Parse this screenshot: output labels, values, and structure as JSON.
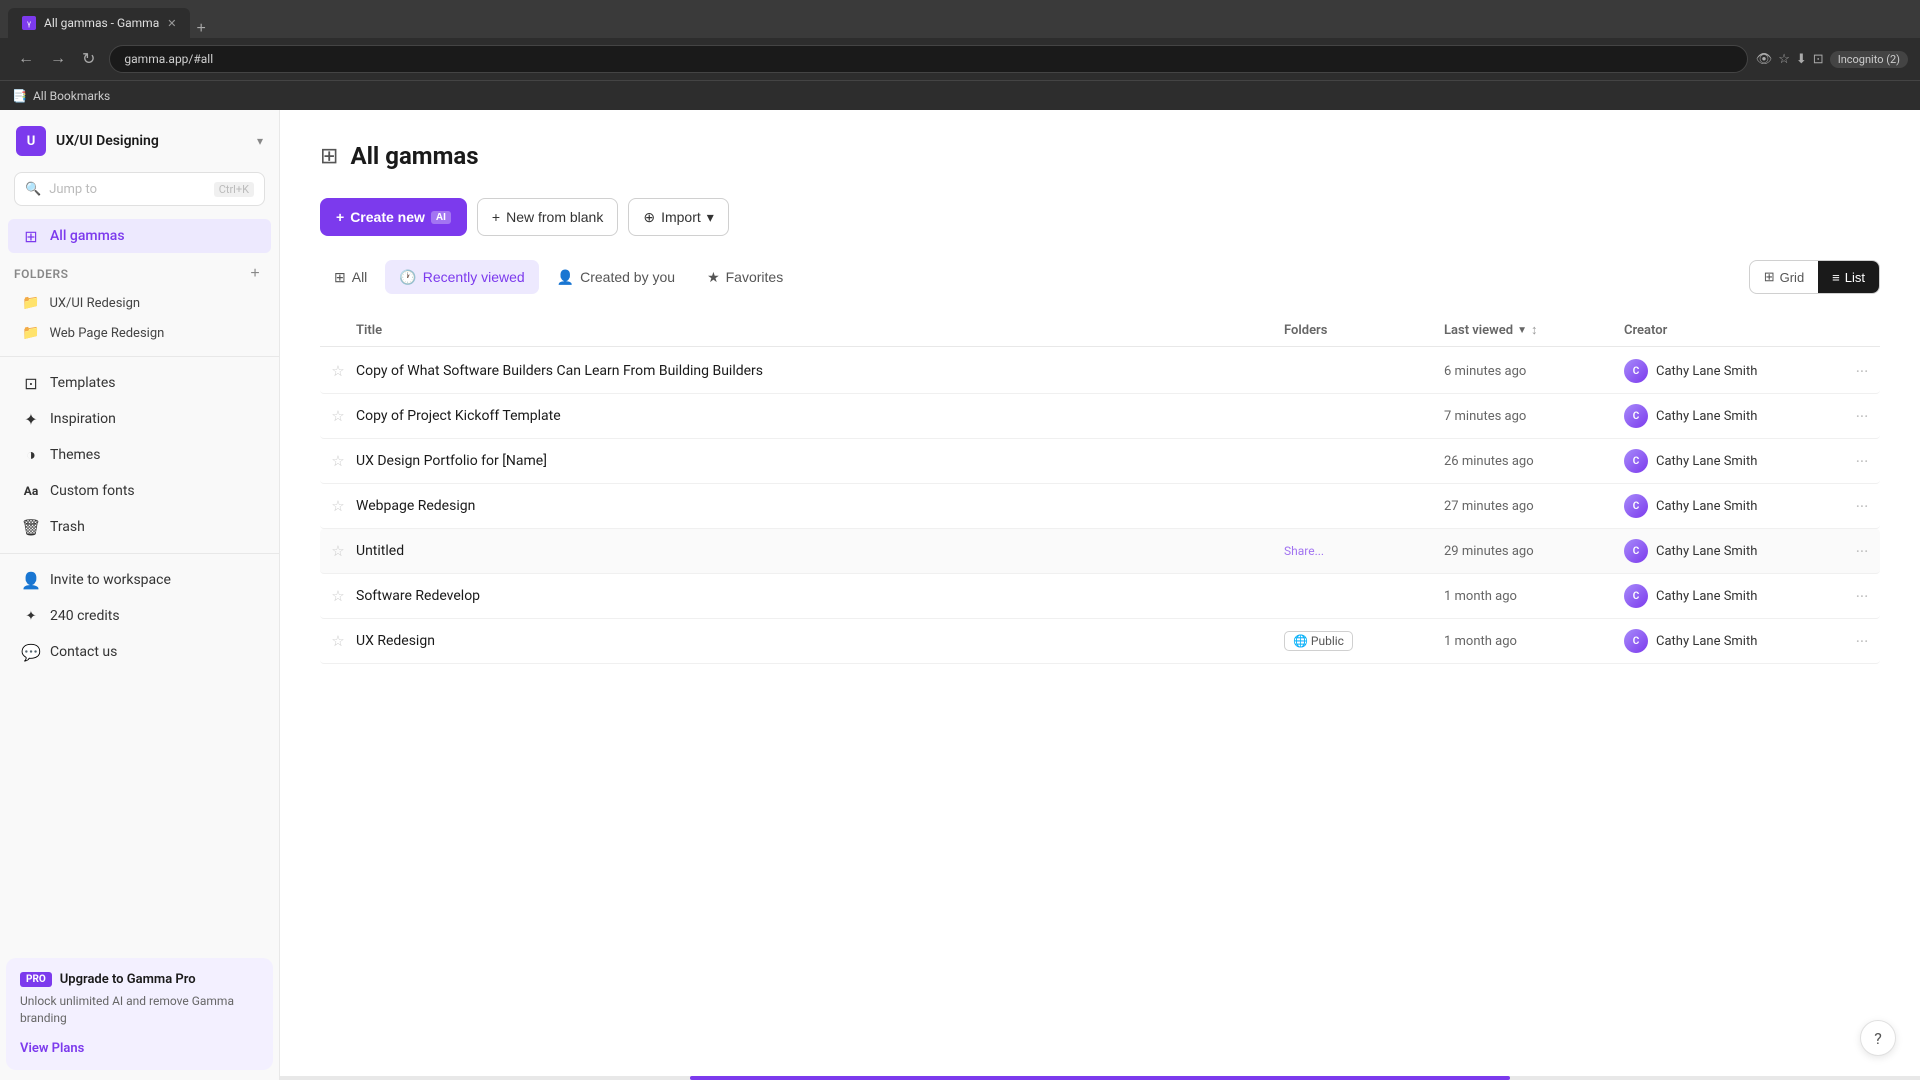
{
  "browser": {
    "tab_title": "All gammas - Gamma",
    "tab_url": "gamma.app/#all",
    "new_tab_btn": "+",
    "nav": {
      "back": "←",
      "forward": "→",
      "refresh": "↻",
      "address": "gamma.app/#all"
    },
    "incognito": "Incognito (2)",
    "bookmarks_bar": "All Bookmarks"
  },
  "sidebar": {
    "workspace": {
      "avatar_letter": "U",
      "name": "UX/UI Designing",
      "chevron": "▾"
    },
    "search": {
      "placeholder": "Jump to",
      "shortcut": "Ctrl+K"
    },
    "nav_items": [
      {
        "id": "all-gammas",
        "label": "All gammas",
        "icon": "⊞",
        "active": true
      },
      {
        "id": "templates",
        "label": "Templates",
        "icon": "⊡"
      },
      {
        "id": "inspiration",
        "label": "Inspiration",
        "icon": "✦"
      },
      {
        "id": "themes",
        "label": "Themes",
        "icon": "◑"
      },
      {
        "id": "custom-fonts",
        "label": "Custom fonts",
        "icon": "Aa"
      },
      {
        "id": "trash",
        "label": "Trash",
        "icon": "🗑"
      }
    ],
    "folders_label": "Folders",
    "folders": [
      {
        "label": "UX/UI Redesign",
        "icon": "📁"
      },
      {
        "label": "Web Page Redesign",
        "icon": "📁"
      }
    ],
    "bottom_items": [
      {
        "id": "invite",
        "label": "Invite to workspace",
        "icon": "👤"
      },
      {
        "id": "credits",
        "label": "240 credits",
        "icon": "✦"
      },
      {
        "id": "contact",
        "label": "Contact us",
        "icon": "💬"
      }
    ],
    "upgrade": {
      "pro_label": "PRO",
      "title": "Upgrade to Gamma Pro",
      "description": "Unlock unlimited AI and remove Gamma branding",
      "cta": "View Plans"
    }
  },
  "main": {
    "page_title": "All gammas",
    "page_icon": "⊞",
    "actions": {
      "create": "+ Create new",
      "ai_badge": "AI",
      "new_blank": "+ New from blank",
      "import": "⊕ Import"
    },
    "filters": [
      {
        "id": "all",
        "label": "All",
        "icon": "⊞"
      },
      {
        "id": "recently-viewed",
        "label": "Recently viewed",
        "icon": "🕐",
        "active": true
      },
      {
        "id": "created-by-you",
        "label": "Created by you",
        "icon": "👤"
      },
      {
        "id": "favorites",
        "label": "Favorites",
        "icon": "★"
      }
    ],
    "view_toggle": {
      "grid": "Grid",
      "list": "List",
      "active": "list"
    },
    "table": {
      "columns": [
        "",
        "Title",
        "Folders",
        "Last viewed",
        "Creator",
        ""
      ],
      "sort_icon": "↕",
      "sort_col": "Last viewed",
      "rows": [
        {
          "starred": false,
          "title": "Copy of What Software Builders Can Learn From Building Builders",
          "folder": "",
          "last_viewed": "6 minutes ago",
          "creator": "Cathy Lane Smith",
          "share": ""
        },
        {
          "starred": false,
          "title": "Copy of Project Kickoff Template",
          "folder": "",
          "last_viewed": "7 minutes ago",
          "creator": "Cathy Lane Smith",
          "share": ""
        },
        {
          "starred": false,
          "title": "UX Design Portfolio for [Name]",
          "folder": "",
          "last_viewed": "26 minutes ago",
          "creator": "Cathy Lane Smith",
          "share": ""
        },
        {
          "starred": false,
          "title": "Webpage Redesign",
          "folder": "",
          "last_viewed": "27 minutes ago",
          "creator": "Cathy Lane Smith",
          "share": ""
        },
        {
          "starred": false,
          "title": "Untitled",
          "folder": "",
          "last_viewed": "29 minutes ago",
          "creator": "Cathy Lane Smith",
          "share": "Share..."
        },
        {
          "starred": false,
          "title": "Software Redevelop",
          "folder": "",
          "last_viewed": "1 month ago",
          "creator": "Cathy Lane Smith",
          "share": ""
        },
        {
          "starred": false,
          "title": "UX Redesign",
          "folder": "🌐 Public",
          "last_viewed": "1 month ago",
          "creator": "Cathy Lane Smith",
          "share": ""
        }
      ]
    }
  },
  "icons": {
    "star_empty": "☆",
    "star_filled": "★",
    "more": "···",
    "grid_view": "⊞",
    "list_view": "≡",
    "globe": "🌐",
    "clock": "🕐",
    "search": "🔍",
    "folder": "📁",
    "plus": "+",
    "chevron_down": "▾",
    "sort": "↕",
    "help": "?"
  }
}
